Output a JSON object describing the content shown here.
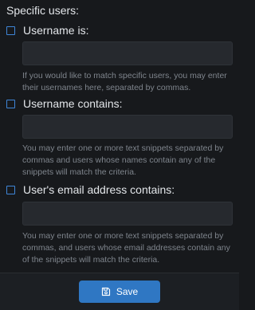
{
  "section": {
    "title": "Specific users:"
  },
  "options": [
    {
      "label": "Username is:",
      "checked": false,
      "value": "",
      "help": "If you would like to match specific users, you may enter their usernames here, separated by commas."
    },
    {
      "label": "Username contains:",
      "checked": false,
      "value": "",
      "help": "You may enter one or more text snippets separated by commas and users whose names contain any of the snippets will match the criteria."
    },
    {
      "label": "User's email address contains:",
      "checked": false,
      "value": "",
      "help": "You may enter one or more text snippets separated by commas, and users whose email addresses contain any of the snippets will match the criteria."
    }
  ],
  "footer": {
    "save_label": "Save",
    "save_icon": "floppy-disk-icon"
  },
  "colors": {
    "background": "#17191c",
    "input_background": "#26292e",
    "accent": "#2f77c3",
    "checkbox_border": "#3f86d8",
    "help_text": "#7f858d"
  }
}
